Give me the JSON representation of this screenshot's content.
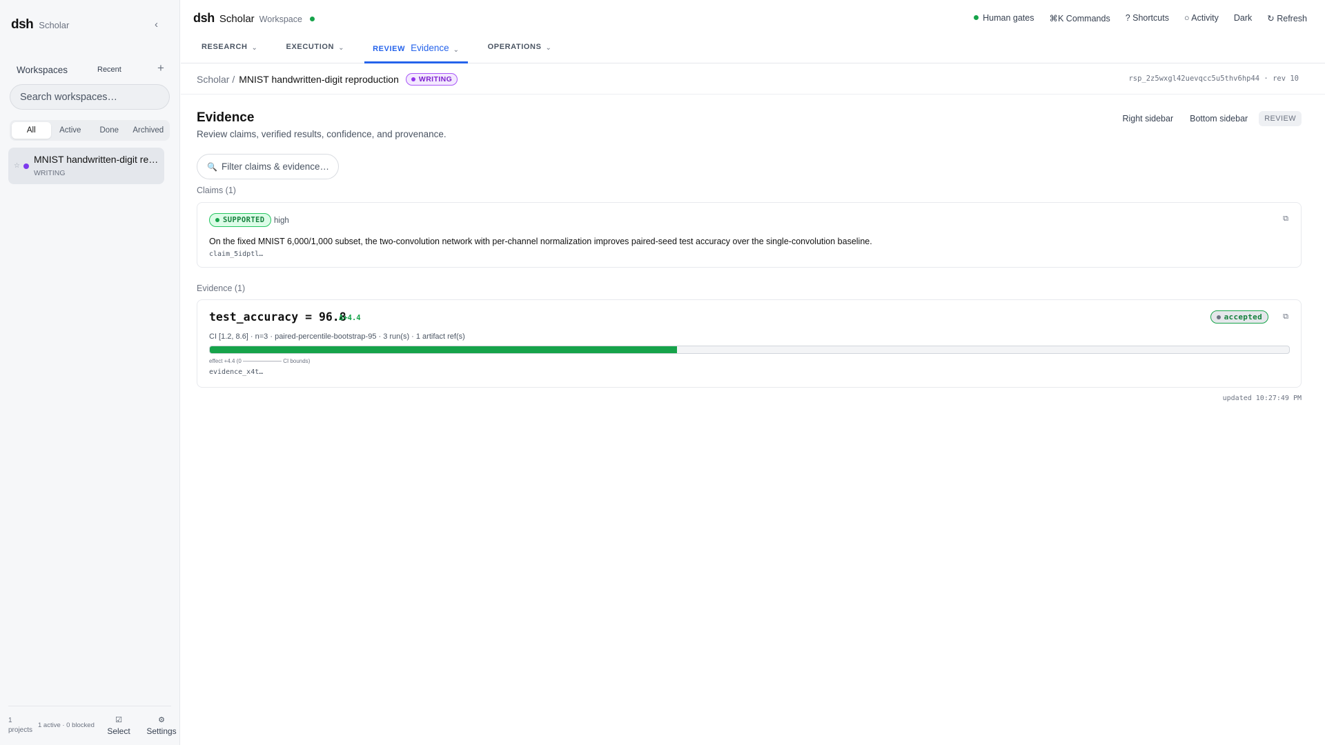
{
  "sidebar": {
    "logo": "dsh",
    "subtitle": "Scholar",
    "collapse_icon": "‹",
    "workspaces_title": "Workspaces",
    "recent_label": "Recent",
    "add_icon": "+",
    "search_placeholder": "Search workspaces…",
    "filter_tabs": [
      "All",
      "Active",
      "Done",
      "Archived"
    ],
    "active_filter": "All",
    "projects": [
      {
        "star": "☆",
        "name": "MNIST handwritten-digit reproduction",
        "status": "WRITING",
        "color": "#7c3aed"
      }
    ],
    "footer": {
      "count": "1 projects",
      "meta": "1 active · 0 blocked",
      "select_label": "Select",
      "select_icon": "☑",
      "settings_label": "Settings",
      "settings_icon": "⚙"
    }
  },
  "header": {
    "logo": "dsh",
    "app_name": "Scholar",
    "context": "Workspace",
    "status_color": "#16a34a",
    "actions": {
      "human_gates": "Human gates",
      "commands": "⌘K Commands",
      "shortcuts": "? Shortcuts",
      "activity": "○ Activity",
      "theme": "Dark",
      "refresh": "↻ Refresh"
    },
    "tabs": [
      {
        "label": "RESEARCH",
        "sub": "",
        "active": false
      },
      {
        "label": "EXECUTION",
        "sub": "",
        "active": false
      },
      {
        "label": "REVIEW",
        "sub": "Evidence",
        "active": true
      },
      {
        "label": "OPERATIONS",
        "sub": "",
        "active": false
      }
    ],
    "chevron": "⌄"
  },
  "breadcrumb": {
    "root": "Scholar /",
    "page": "MNIST handwritten-digit reproduction",
    "badge": "WRITING",
    "run_id": "rsp_2z5wxgl42uevqcc5u5thv6hp44 · rev 10"
  },
  "main": {
    "title": "Evidence",
    "subtitle": "Review claims, verified results, confidence, and provenance.",
    "view_buttons": {
      "right": "Right sidebar",
      "bottom": "Bottom sidebar",
      "mode": "REVIEW"
    },
    "filter_placeholder": "Filter claims & evidence…",
    "claims_label": "Claims (1)",
    "claim": {
      "status": "SUPPORTED",
      "confidence": "high",
      "text": "On the fixed MNIST 6,000/1,000 subset, the two-convolution network with per-channel normalization improves paired-seed test accuracy over the single-convolution baseline.",
      "id": "claim_5idptl…"
    },
    "evidence_label": "Evidence (1)",
    "evidence": {
      "metric": "test_accuracy = 96.8",
      "delta": "Δ+4.4",
      "status": "accepted",
      "meta": "CI [1.2, 8.6] · n=3 · paired-percentile-bootstrap-95 · 3 run(s) · 1 artifact ref(s)",
      "bar_fraction": 0.433,
      "bar_color": "#16a34a",
      "bar_note": "effect +4.4 (0 ——————— CI bounds)",
      "id": "evidence_x4t…"
    },
    "updated": "updated 10:27:49 PM",
    "copy_icon": "⧉"
  }
}
